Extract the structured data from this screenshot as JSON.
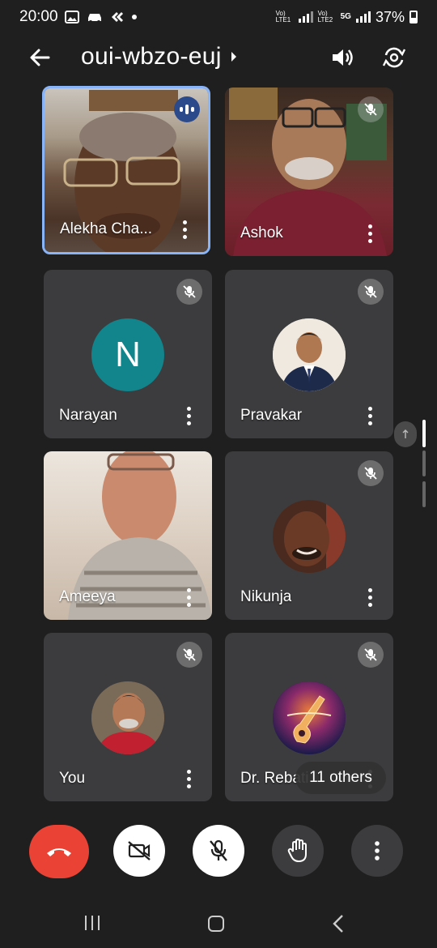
{
  "status_bar": {
    "time": "20:00",
    "battery": "37%",
    "lte1": "Vo) LTE1",
    "lte2": "Vo) LTE2",
    "network": "5G"
  },
  "top_bar": {
    "meeting_code": "oui-wbzo-euj"
  },
  "participants": [
    {
      "name": "Alekha Cha...",
      "state": "speaking"
    },
    {
      "name": "Ashok",
      "state": "muted"
    },
    {
      "name": "Narayan",
      "initial": "N",
      "state": "muted"
    },
    {
      "name": "Pravakar",
      "state": "muted"
    },
    {
      "name": "Ameeya",
      "state": "video"
    },
    {
      "name": "Nikunja",
      "state": "muted"
    },
    {
      "name": "You",
      "state": "muted"
    },
    {
      "name": "Dr. Rebati",
      "state": "muted"
    }
  ],
  "others_label": "11 others",
  "colors": {
    "background": "#1f1f1f",
    "tile": "#3c3c3e",
    "end_call": "#ea4335",
    "active_border": "#8ab4f8",
    "narayan_avatar": "#12848b"
  }
}
